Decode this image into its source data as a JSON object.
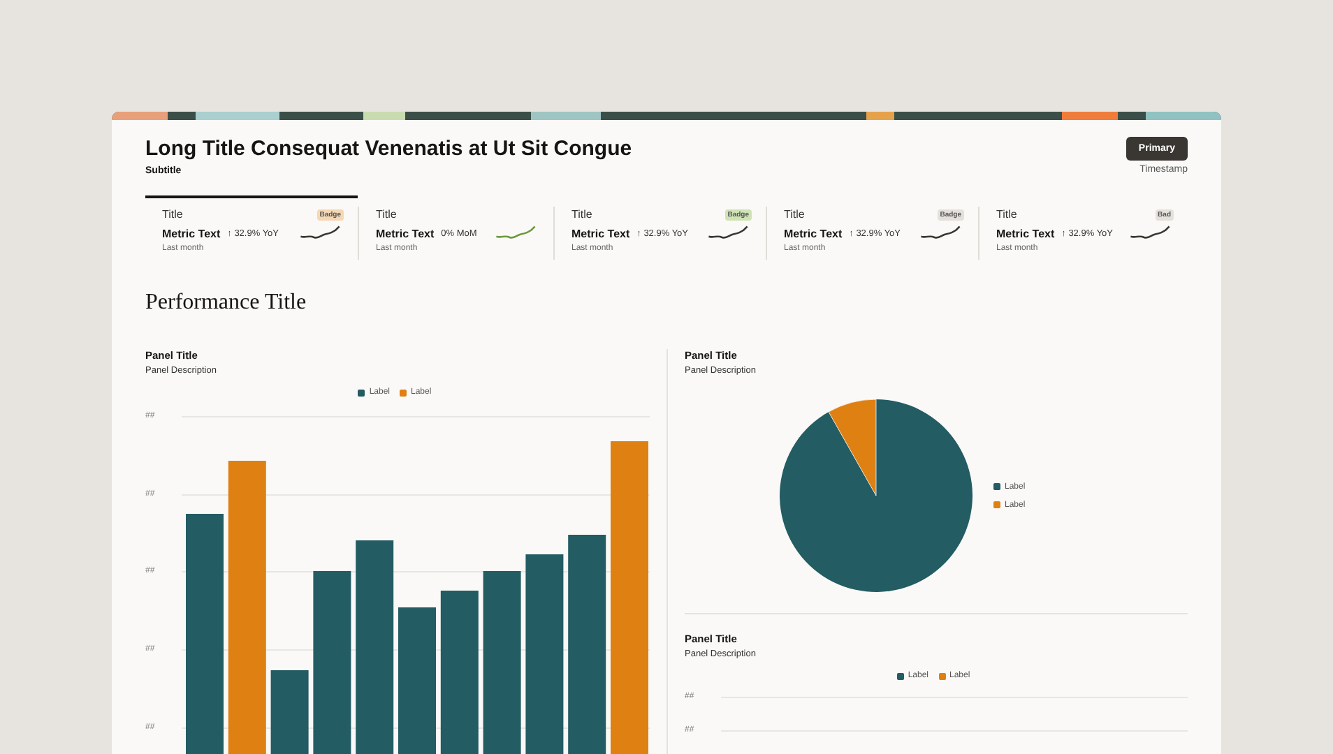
{
  "header": {
    "title": "Long Title Consequat Venenatis at Ut Sit Congue",
    "subtitle": "Subtitle",
    "primary_button": "Primary",
    "timestamp": "Timestamp"
  },
  "metrics": [
    {
      "title": "Title",
      "selected": true,
      "badge": {
        "text": "Badge",
        "color": "#f6d7b4"
      },
      "value": "Metric Text",
      "delta": "↑ 32.9% YoY",
      "sparkline": {
        "color": "#3a3632"
      },
      "caption": "Last month"
    },
    {
      "title": "Title",
      "selected": false,
      "value": "Metric Text",
      "delta": "0% MoM",
      "sparkline": {
        "color": "#6a9a3c"
      },
      "caption": "Last month"
    },
    {
      "title": "Title",
      "selected": false,
      "badge": {
        "text": "Badge",
        "color": "#cfe3b4"
      },
      "value": "Metric Text",
      "delta": "↑ 32.9% YoY",
      "sparkline": {
        "color": "#3a3632"
      },
      "caption": "Last month"
    },
    {
      "title": "Title",
      "selected": false,
      "badge": {
        "text": "Badge",
        "color": "#e4e1dc"
      },
      "value": "Metric Text",
      "delta": "↑ 32.9% YoY",
      "sparkline": {
        "color": "#3a3632"
      },
      "caption": "Last month"
    },
    {
      "title": "Title",
      "selected": false,
      "badge": {
        "text": "Bad",
        "color": "#e4e1dc"
      },
      "value": "Metric Text",
      "delta": "↑ 32.9% YoY",
      "sparkline": {
        "color": "#3a3632"
      },
      "caption": "Last month"
    }
  ],
  "section_title": "Performance Title",
  "panels": [
    {
      "kind": "bar",
      "title": "Panel Title",
      "description": "Panel Description",
      "legend": [
        {
          "label": "Label",
          "color": "#235c63"
        },
        {
          "label": "Label",
          "color": "#df8013"
        }
      ],
      "y_labels": [
        "##",
        "##",
        "##",
        "##",
        "##"
      ]
    },
    {
      "kind": "pie",
      "title": "Panel Title",
      "description": "Panel Description",
      "legend": [
        {
          "label": "Label",
          "color": "#235c63"
        },
        {
          "label": "Label",
          "color": "#df8013"
        }
      ]
    },
    {
      "kind": "bar",
      "title": "Panel Title",
      "description": "Panel Description",
      "legend": [
        {
          "label": "Label",
          "color": "#235c63"
        },
        {
          "label": "Label",
          "color": "#df8013"
        }
      ],
      "y_labels": [
        "##",
        "##"
      ]
    }
  ]
}
